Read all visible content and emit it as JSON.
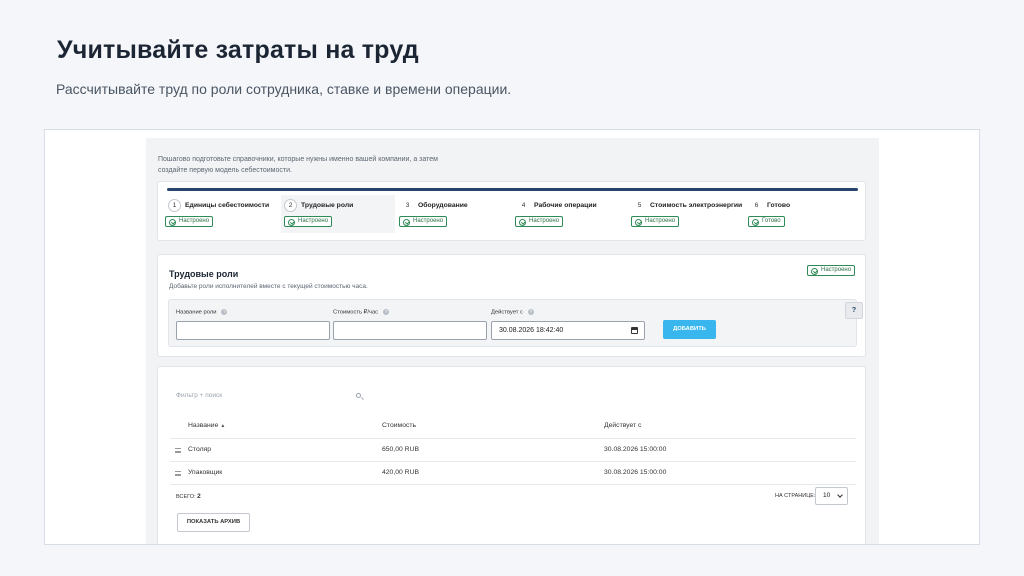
{
  "slide": {
    "title": "Учитывайте затраты на труд",
    "subtitle": "Рассчитывайте труд по роли сотрудника, ставке и времени операции."
  },
  "intro": {
    "line1": "Пошагово подготовьте справочники, которые нужны именно вашей компании, а затем",
    "line2": "создайте первую модель себестоимости."
  },
  "stepper": {
    "steps": [
      {
        "num": "1",
        "label": "Единицы себестоимости",
        "status": "Настроено"
      },
      {
        "num": "2",
        "label": "Трудовые роли",
        "status": "Настроено"
      },
      {
        "num": "3",
        "label": "Оборудование",
        "status": "Настроено"
      },
      {
        "num": "4",
        "label": "Рабочие операции",
        "status": "Настроено"
      },
      {
        "num": "5",
        "label": "Стоимость электроэнергии",
        "status": "Настроено"
      },
      {
        "num": "6",
        "label": "Готово",
        "status": "Готово"
      }
    ],
    "active_index": 1
  },
  "roles": {
    "title": "Трудовые роли",
    "description": "Добавьте роли исполнителей вместе с текущей стоимостью часа.",
    "status": "Настроено",
    "form": {
      "name_label": "Название роли",
      "name_value": "",
      "cost_label": "Стоимость ₽/час",
      "cost_value": "",
      "date_label": "Действует с",
      "date_value": "30.08.2026 18:42:40",
      "add_button": "ДОБАВИТЬ",
      "help_button": "?"
    }
  },
  "table": {
    "filter_placeholder": "Фильтр + поиск",
    "columns": {
      "name": "Название",
      "cost": "Стоимость",
      "since": "Действует с"
    },
    "rows": [
      {
        "name": "Столяр",
        "cost": "650,00 RUB",
        "since": "30.08.2026 15:00:00"
      },
      {
        "name": "Упаковщик",
        "cost": "420,00 RUB",
        "since": "30.08.2026 15:00:00"
      }
    ],
    "total_label": "ВСЕГО:",
    "total_value": "2",
    "per_page_label": "НА СТРАНИЦЕ:",
    "per_page_value": "10",
    "archive_button": "ПОКАЗАТЬ АРХИВ"
  },
  "colors": {
    "accent": "#39b6ee",
    "progress": "#26466d",
    "success": "#2e8b57"
  }
}
